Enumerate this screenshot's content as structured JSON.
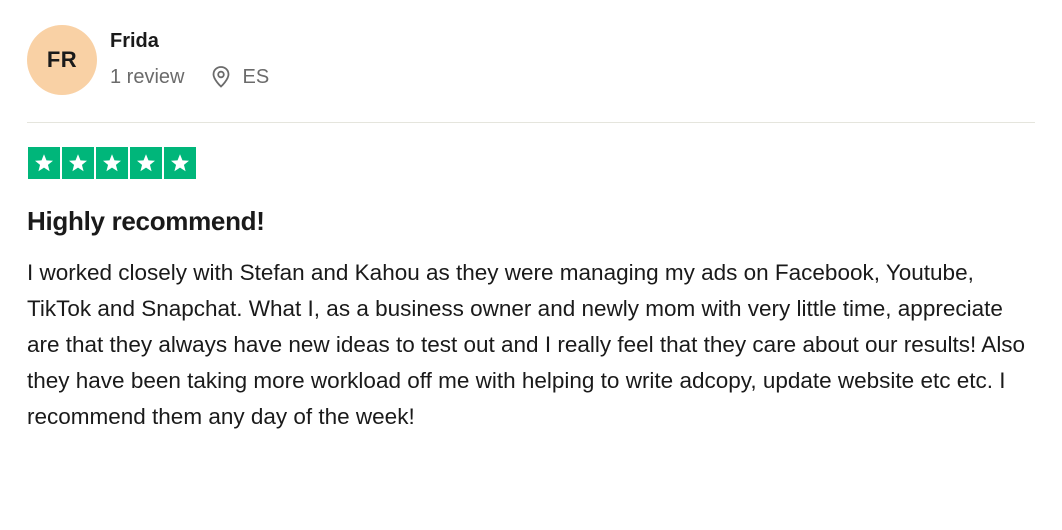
{
  "reviewer": {
    "initials": "FR",
    "name": "Frida",
    "review_count": "1 review",
    "country": "ES",
    "avatar_color": "#f9d1a5"
  },
  "rating": {
    "stars": 5,
    "max_stars": 5,
    "star_color": "#00b67a",
    "icon": "star-icon"
  },
  "review": {
    "title": "Highly recommend!",
    "body": "I worked closely with Stefan and Kahou as they were managing my ads on Facebook, Youtube, TikTok and Snapchat. What I, as a business owner and newly mom with very little time, appreciate are that they always have new ideas to test out and I really feel that they care about our results! Also they have been taking more workload off me with helping to write adcopy, update website etc etc. I recommend them any day of the week!"
  },
  "icons": {
    "location": "location-pin-icon"
  }
}
